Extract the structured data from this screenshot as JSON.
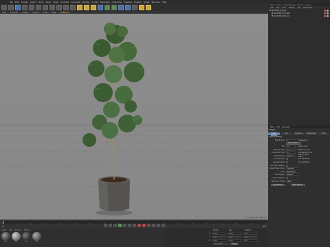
{
  "menubar": {
    "items": [
      "File",
      "Edit",
      "Create",
      "Select",
      "Tools",
      "Mesh",
      "Snap",
      "Animate",
      "Simulate",
      "Render",
      "Sculpt",
      "MoGraph",
      "Character",
      "Pipeline",
      "Plugins",
      "Script",
      "Window",
      "Help"
    ]
  },
  "viewport": {
    "menu": [
      "View",
      "Cameras",
      "Display",
      "Options",
      "Filter",
      "Panel"
    ],
    "active_tab": "ProRender",
    "footer": "Grid Spacing : 10000 cm"
  },
  "object_manager": {
    "tabs": [
      "Objects",
      "Takes",
      "Content Browser",
      "Structure",
      "Layers"
    ],
    "menu": [
      "File",
      "Edit",
      "View",
      "Objects",
      "Tags",
      "Bookmarks"
    ],
    "objects": [
      {
        "name": "plant_002_dry_obj"
      },
      {
        "name": "plant_002_dry_mesh"
      },
      {
        "name": "plant_002_bsgh_obj"
      }
    ]
  },
  "attribute_manager": {
    "menu": [
      "Mode",
      "Edit",
      "User Data"
    ],
    "title": "Project",
    "tabs": [
      "Project Settings",
      "Info",
      "Dynamics",
      "Referencing",
      "To Do"
    ],
    "section": "Project Settings",
    "rows": [
      {
        "label": "Project Scale",
        "value": "1",
        "unit": "Centimeters"
      },
      {
        "label": "FPS",
        "value": "30",
        "label2": "Project Time",
        "value2": "0 F"
      },
      {
        "label": "Minimum Time",
        "value": "0 F",
        "label2": "Maximum Time",
        "value2": "90 F"
      },
      {
        "label": "Preview Min Time",
        "value": "0 F",
        "label2": "Preview Max Time",
        "value2": "90 F"
      },
      {
        "label": "Level of Detail",
        "value": "100 %",
        "label2": "Render LOD in Editor"
      },
      {
        "label": "Use Animation",
        "label2": "Use Expression"
      },
      {
        "label": "Use Generators",
        "label2": "Use Deformers"
      },
      {
        "label": "Use Motion System"
      },
      {
        "label": "Default Object Color",
        "value": "Gray Blue"
      },
      {
        "label": "Color"
      },
      {
        "label": "View Clipping",
        "value": "Medium"
      },
      {
        "label": "Linear Workflow"
      },
      {
        "label": "Input Color Profile",
        "value": "sRGB"
      }
    ],
    "scale_button": "Scale Project...",
    "buttons": [
      "Load Preset...",
      "Save Preset..."
    ]
  },
  "timeline": {
    "ticks": [
      "0",
      "5",
      "10",
      "15",
      "20",
      "25",
      "30",
      "35",
      "40",
      "45",
      "50",
      "55",
      "60",
      "65",
      "70",
      "75",
      "80",
      "85",
      "90"
    ],
    "frame_left": "0 F",
    "frame_right": "90 F"
  },
  "material_manager": {
    "menu": [
      "Create",
      "Edit",
      "Function",
      "Texture"
    ],
    "materials": [
      {
        "name": "Mat",
        "color": "#5a5a5a"
      },
      {
        "name": "Mat",
        "color": "#8a8a8a"
      },
      {
        "name": "Mat",
        "color": "#3f3f3f"
      },
      {
        "name": "Mat",
        "color": "#6b6b6b"
      }
    ]
  },
  "coordinates": {
    "headers": [
      "Position",
      "Size",
      "Rotation"
    ],
    "rows": [
      {
        "axis": "X",
        "pos": "0 cm",
        "size": "0 cm",
        "rot": "H 0 °"
      },
      {
        "axis": "Y",
        "pos": "0 cm",
        "size": "0 cm",
        "rot": "P 0 °"
      },
      {
        "axis": "Z",
        "pos": "0 cm",
        "size": "0 cm",
        "rot": "B 0 °"
      }
    ],
    "mode": "Object (Rel)",
    "apply": "Apply"
  },
  "colors": {
    "accent": "#5d7fb4",
    "active_tab": "#ffcc33",
    "record": "#c54545"
  }
}
